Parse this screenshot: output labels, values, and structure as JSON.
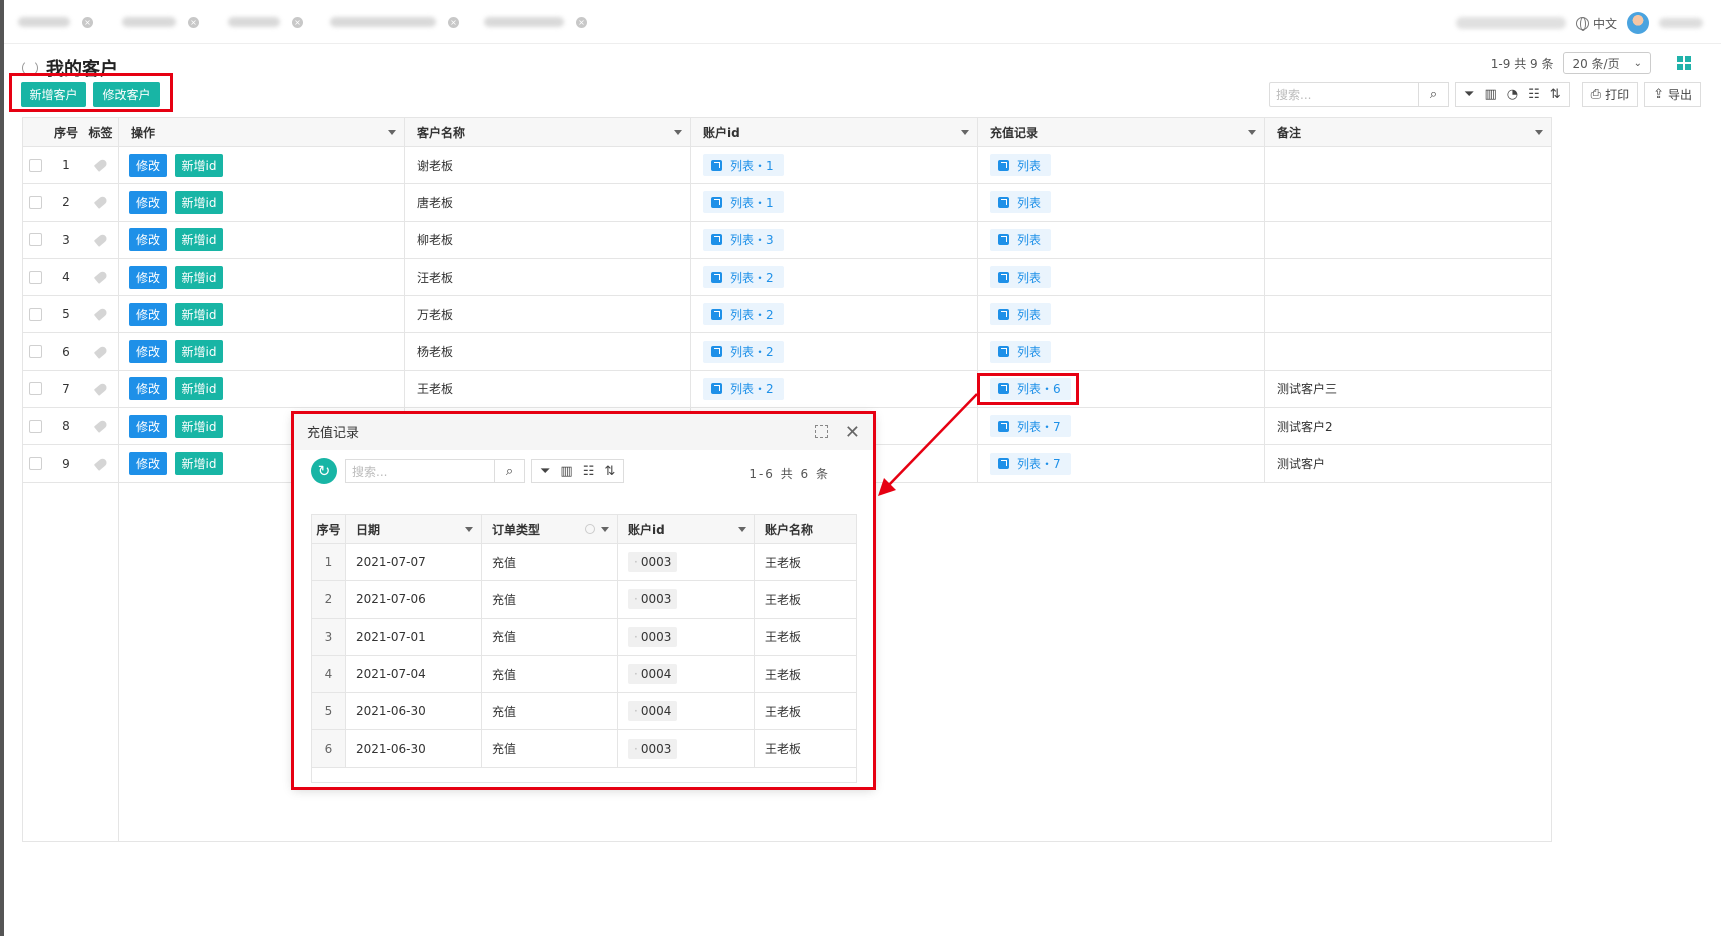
{
  "top_tabs": [
    "",
    "",
    "",
    "",
    ""
  ],
  "header": {
    "language": "中文"
  },
  "page": {
    "title": "我的客户",
    "pager_text": "1-9 共 9 条",
    "page_size": "20 条/页"
  },
  "actions": {
    "add_customer": "新增客户",
    "edit_customer": "修改客户"
  },
  "toolbar": {
    "search_placeholder": "搜索...",
    "print": "打印",
    "export": "导出"
  },
  "table": {
    "columns": {
      "idx": "序号",
      "tag": "标签",
      "op": "操作",
      "name": "客户名称",
      "account": "账户id",
      "recharge": "充值记录",
      "note": "备注"
    },
    "op_edit": "修改",
    "op_add_id": "新增id",
    "rows": [
      {
        "idx": "1",
        "name": "谢老板",
        "account": "列表・1",
        "recharge": "列表",
        "note": ""
      },
      {
        "idx": "2",
        "name": "唐老板",
        "account": "列表・1",
        "recharge": "列表",
        "note": ""
      },
      {
        "idx": "3",
        "name": "柳老板",
        "account": "列表・3",
        "recharge": "列表",
        "note": ""
      },
      {
        "idx": "4",
        "name": "汪老板",
        "account": "列表・2",
        "recharge": "列表",
        "note": ""
      },
      {
        "idx": "5",
        "name": "万老板",
        "account": "列表・2",
        "recharge": "列表",
        "note": ""
      },
      {
        "idx": "6",
        "name": "杨老板",
        "account": "列表・2",
        "recharge": "列表",
        "note": ""
      },
      {
        "idx": "7",
        "name": "王老板",
        "account": "列表・2",
        "recharge": "列表・6",
        "note": "测试客户三"
      },
      {
        "idx": "8",
        "name": "",
        "account": "",
        "recharge": "列表・7",
        "note": "测试客户2"
      },
      {
        "idx": "9",
        "name": "",
        "account": "",
        "recharge": "列表・7",
        "note": "测试客户"
      }
    ]
  },
  "popup": {
    "title": "充值记录",
    "search_placeholder": "搜索...",
    "pager_text": "1-6 共 6 条",
    "columns": {
      "idx": "序号",
      "date": "日期",
      "type": "订单类型",
      "account": "账户id",
      "name": "账户名称"
    },
    "rows": [
      {
        "idx": "1",
        "date": "2021-07-07",
        "type": "充值",
        "account": "0003",
        "name": "王老板"
      },
      {
        "idx": "2",
        "date": "2021-07-06",
        "type": "充值",
        "account": "0003",
        "name": "王老板"
      },
      {
        "idx": "3",
        "date": "2021-07-01",
        "type": "充值",
        "account": "0003",
        "name": "王老板"
      },
      {
        "idx": "4",
        "date": "2021-07-04",
        "type": "充值",
        "account": "0004",
        "name": "王老板"
      },
      {
        "idx": "5",
        "date": "2021-06-30",
        "type": "充值",
        "account": "0004",
        "name": "王老板"
      },
      {
        "idx": "6",
        "date": "2021-06-30",
        "type": "充值",
        "account": "0003",
        "name": "王老板"
      }
    ]
  },
  "colors": {
    "accent_teal": "#18b5a5",
    "link_blue": "#1e90e8",
    "highlight_red": "#e60012"
  },
  "icons": [
    "refresh-icon",
    "search-icon",
    "filter-icon",
    "chart-icon",
    "pie-icon",
    "settings-list-icon",
    "sort-icon",
    "print-icon",
    "export-icon",
    "expand-icon",
    "close-icon",
    "globe-icon",
    "grid-icon",
    "tag-icon",
    "external-link-icon"
  ]
}
